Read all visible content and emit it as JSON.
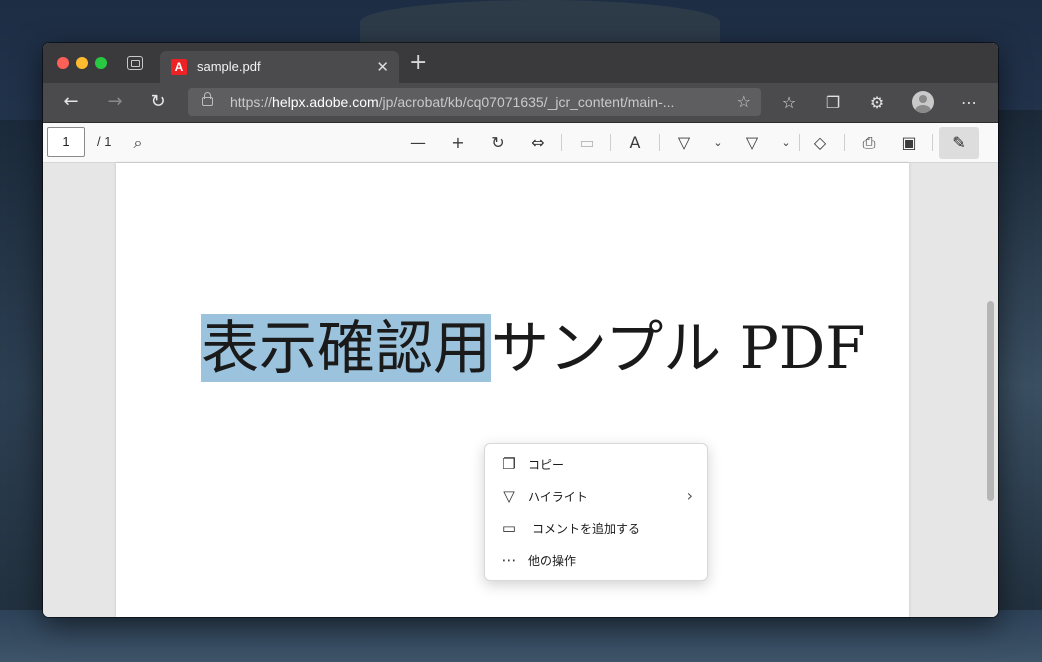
{
  "browser": {
    "tab_title": "sample.pdf",
    "tab_close": "✕",
    "new_tab": "+",
    "url_prefix": "https://",
    "url_host": "helpx.adobe.com",
    "url_path": "/jp/acrobat/kb/cq07071635/_jcr_content/main-..."
  },
  "icons": {
    "tab_actions": "tab-actions-icon",
    "back": "back-arrow-icon",
    "forward": "forward-arrow-icon",
    "refresh": "refresh-icon",
    "lock": "lock-icon",
    "add_favorite": "add-favorite-icon",
    "favorites": "favorites-icon",
    "collections": "collections-icon",
    "extensions": "extensions-icon",
    "profile": "profile-avatar-icon",
    "more": "more-icon"
  },
  "pdf_toolbar": {
    "page_number": "1",
    "page_total": "/ 1",
    "tools": [
      "search-icon",
      "zoom-out-icon",
      "zoom-in-icon",
      "rotate-icon",
      "fit-width-icon",
      "page-view-icon",
      "read-aloud-icon",
      "draw-icon",
      "highlight-icon",
      "erase-icon",
      "print-icon",
      "save-icon",
      "pin-icon"
    ]
  },
  "document": {
    "selected_text": "表示確認用",
    "remaining_text": "サンプル PDF"
  },
  "context_menu": {
    "items": [
      {
        "label": "コピー",
        "icon": "copy-icon"
      },
      {
        "label": "ハイライト",
        "icon": "highlight-icon",
        "submenu": true
      },
      {
        "label": "コメントを追加する",
        "icon": "comment-icon"
      },
      {
        "label": "他の操作",
        "icon": "more-actions-icon"
      }
    ]
  },
  "colors": {
    "selection": "#9cc3dd",
    "adobe_red": "#ed2224"
  }
}
